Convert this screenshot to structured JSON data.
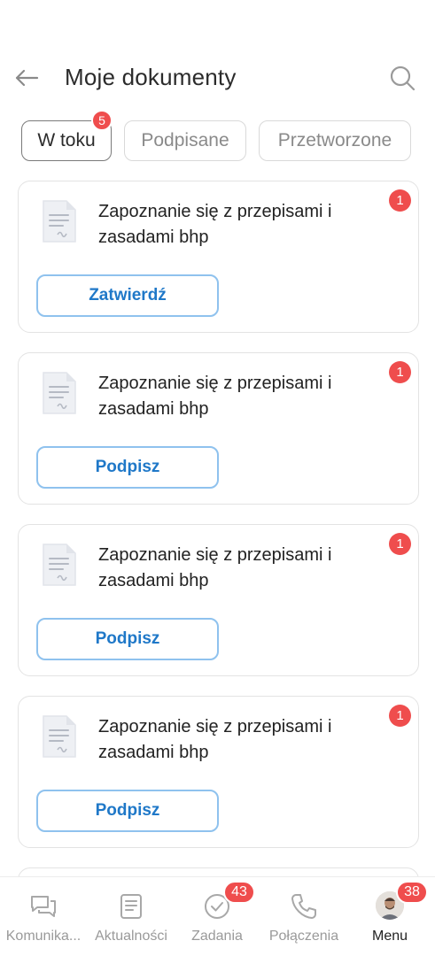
{
  "header": {
    "title": "Moje dokumenty",
    "back_icon": "arrow-left-icon",
    "search_icon": "search-icon"
  },
  "tabs": [
    {
      "label": "W toku",
      "badge": "5",
      "active": true
    },
    {
      "label": "Podpisane",
      "active": false
    },
    {
      "label": "Przetworzone",
      "active": false
    }
  ],
  "documents": [
    {
      "title": "Zapoznanie się z przepisami i zasadami bhp",
      "badge": "1",
      "action": "Zatwierdź",
      "icon": "document-icon"
    },
    {
      "title": "Zapoznanie się z przepisami i zasadami bhp",
      "badge": "1",
      "action": "Podpisz",
      "icon": "document-icon"
    },
    {
      "title": "Zapoznanie się z przepisami i zasadami bhp",
      "badge": "1",
      "action": "Podpisz",
      "icon": "document-icon"
    },
    {
      "title": "Zapoznanie się z przepisami i zasadami bhp",
      "badge": "1",
      "action": "Podpisz",
      "icon": "document-icon"
    }
  ],
  "bottom_nav": [
    {
      "label": "Komunika...",
      "icon": "chat-icon"
    },
    {
      "label": "Aktualności",
      "icon": "news-icon"
    },
    {
      "label": "Zadania",
      "icon": "check-circle-icon",
      "badge": "43"
    },
    {
      "label": "Połączenia",
      "icon": "phone-icon"
    },
    {
      "label": "Menu",
      "icon": "avatar",
      "badge": "38",
      "active": true
    }
  ],
  "colors": {
    "accent": "#1f78c8",
    "badge": "#ef4d4d",
    "button_border": "#8fc2ee"
  }
}
